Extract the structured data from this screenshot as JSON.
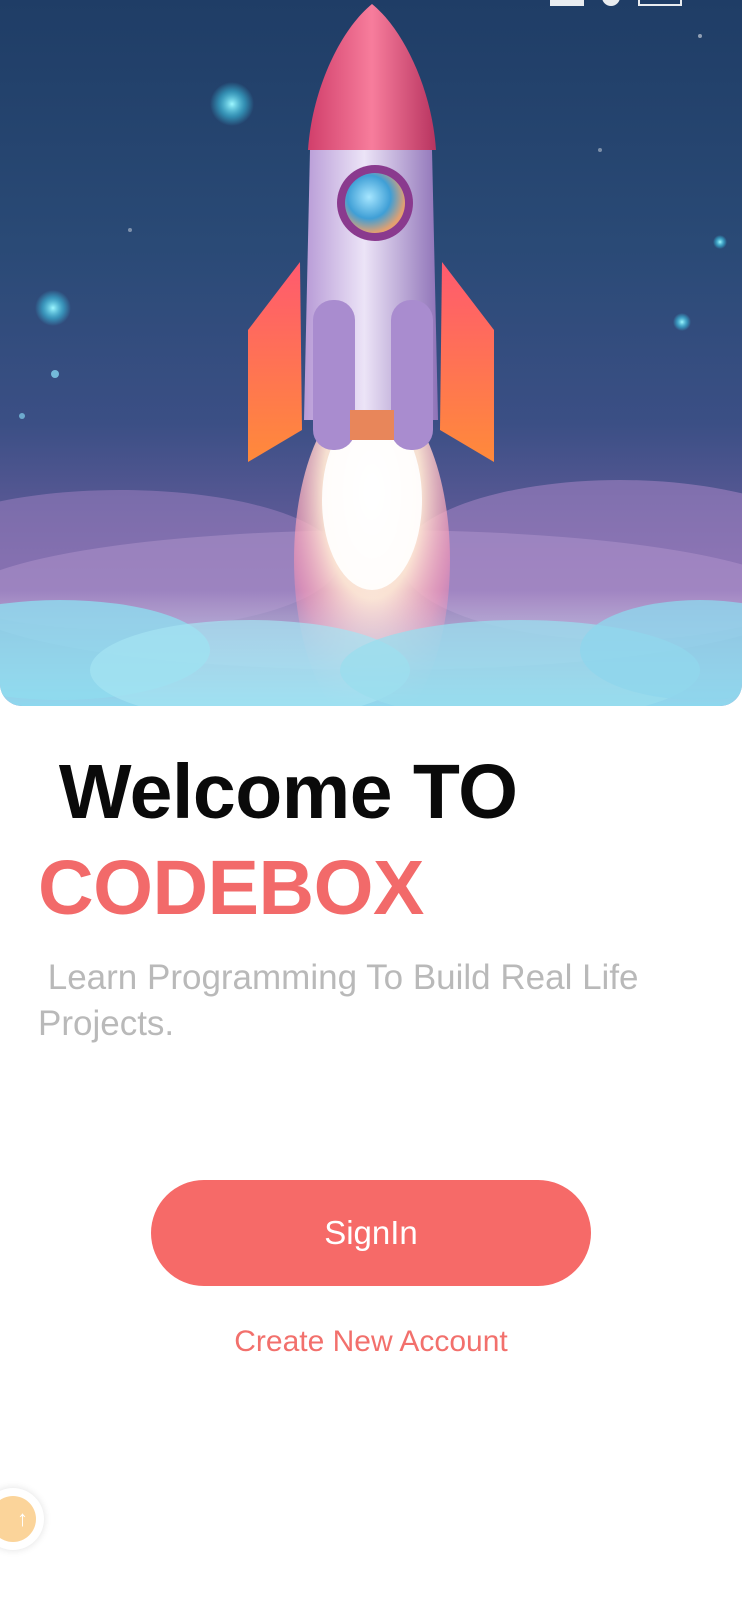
{
  "hero": {
    "image_name": "rocket-launch-illustration"
  },
  "content": {
    "welcome_text": " Welcome TO",
    "brand_name": "CODEBOX",
    "tagline": " Learn Programming To Build Real Life\nProjects."
  },
  "actions": {
    "signin_label": "SignIn",
    "create_account_label": "Create New Account"
  },
  "colors": {
    "brand_accent": "#f26a6a",
    "button_background": "#f66a68",
    "heading_text": "#0a0a0a",
    "tagline_text": "#b9b9b9"
  },
  "icons": {
    "helper_icon": "arrow-up-icon"
  }
}
